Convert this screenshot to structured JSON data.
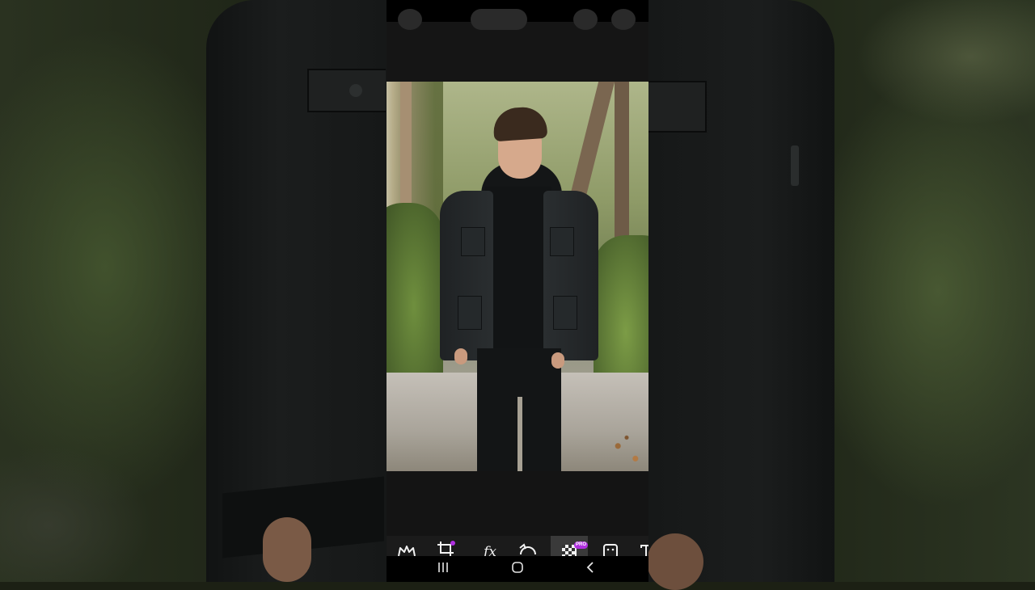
{
  "colors": {
    "accent_purple": "#b02fe0",
    "toolbar_bg": "#1b1b1b",
    "active_tool_bg": "#3a3a3a",
    "nav_bg": "#000000"
  },
  "toolbar": {
    "tools": [
      {
        "icon": "crown-icon",
        "label": ""
      },
      {
        "icon": "crop-icon",
        "label": "",
        "has_dot_badge": true
      },
      {
        "icon": "effects-fx-icon",
        "label": "fx"
      },
      {
        "icon": "retouch-icon",
        "label": ""
      },
      {
        "icon": "remove-background-icon",
        "label": "",
        "badge": "PRO",
        "active": true
      },
      {
        "icon": "sticker-icon",
        "label": ""
      },
      {
        "icon": "text-icon",
        "label": ""
      }
    ]
  },
  "navbar": {
    "buttons": [
      "recent-apps-icon",
      "home-icon",
      "back-icon"
    ]
  }
}
